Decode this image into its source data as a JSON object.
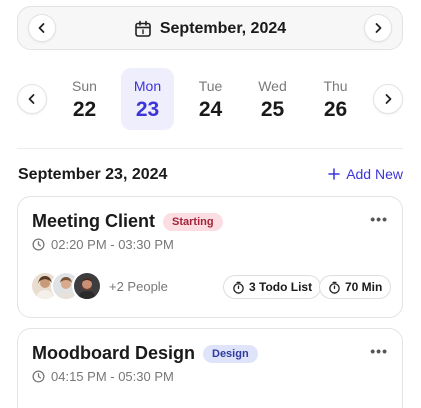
{
  "header": {
    "month_label": "September, 2024"
  },
  "week": [
    {
      "name": "Sun",
      "num": "22"
    },
    {
      "name": "Mon",
      "num": "23",
      "selected": true
    },
    {
      "name": "Tue",
      "num": "24"
    },
    {
      "name": "Wed",
      "num": "25"
    },
    {
      "name": "Thu",
      "num": "26"
    }
  ],
  "schedule": {
    "date_heading": "September 23, 2024",
    "add_new_label": "Add New"
  },
  "events": [
    {
      "title": "Meeting Client",
      "badge": "Starting",
      "time": "02:20 PM - 03:30 PM",
      "people_more": "+2 People",
      "todo": "3 Todo List",
      "duration": "70 Min"
    },
    {
      "title": "Moodboard Design",
      "badge": "Design",
      "time": "04:15 PM - 05:30 PM"
    }
  ],
  "colors": {
    "accent": "#3b35d9",
    "selected_bg": "#eeeefc",
    "badge_starting_bg": "#fbdde2",
    "badge_design_bg": "#dfe4fb"
  }
}
